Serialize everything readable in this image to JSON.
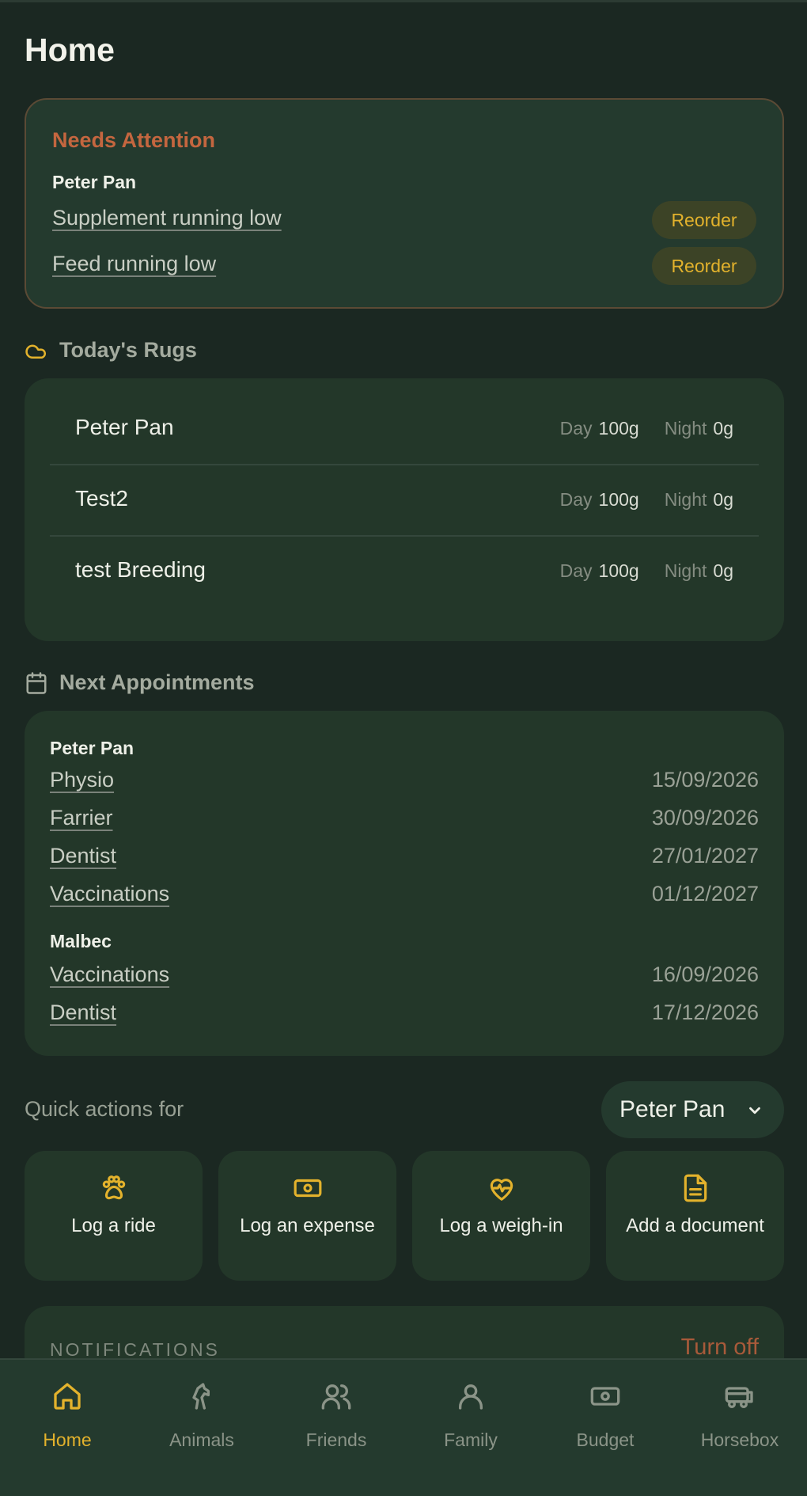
{
  "page": {
    "title": "Home"
  },
  "attention": {
    "title": "Needs Attention",
    "horse": "Peter Pan",
    "items": [
      {
        "label": "Supplement running low",
        "action": "Reorder"
      },
      {
        "label": "Feed running low",
        "action": "Reorder"
      }
    ]
  },
  "rugs": {
    "title": "Today's Rugs",
    "day_label": "Day",
    "night_label": "Night",
    "rows": [
      {
        "name": "Peter Pan",
        "day": "100g",
        "night": "0g"
      },
      {
        "name": "Test2",
        "day": "100g",
        "night": "0g"
      },
      {
        "name": "test Breeding",
        "day": "100g",
        "night": "0g"
      }
    ]
  },
  "appointments": {
    "title": "Next Appointments",
    "groups": [
      {
        "horse": "Peter Pan",
        "items": [
          {
            "type": "Physio",
            "date": "15/09/2026"
          },
          {
            "type": "Farrier",
            "date": "30/09/2026"
          },
          {
            "type": "Dentist",
            "date": "27/01/2027"
          },
          {
            "type": "Vaccinations",
            "date": "01/12/2027"
          }
        ]
      },
      {
        "horse": "Malbec",
        "items": [
          {
            "type": "Vaccinations",
            "date": "16/09/2026"
          },
          {
            "type": "Dentist",
            "date": "17/12/2026"
          }
        ]
      }
    ]
  },
  "quick_actions": {
    "label": "Quick actions for",
    "selected_horse": "Peter Pan",
    "actions": [
      {
        "label": "Log a ride",
        "icon": "paw-icon"
      },
      {
        "label": "Log an expense",
        "icon": "cash-icon"
      },
      {
        "label": "Log a weigh-in",
        "icon": "heart-pulse-icon"
      },
      {
        "label": "Add a document",
        "icon": "document-icon"
      }
    ]
  },
  "notifications": {
    "title": "NOTIFICATIONS",
    "action": "Turn off"
  },
  "nav": {
    "items": [
      {
        "label": "Home",
        "icon": "home-icon",
        "active": true
      },
      {
        "label": "Animals",
        "icon": "horse-icon"
      },
      {
        "label": "Friends",
        "icon": "people-icon"
      },
      {
        "label": "Family",
        "icon": "person-icon"
      },
      {
        "label": "Budget",
        "icon": "cash-icon"
      },
      {
        "label": "Horsebox",
        "icon": "horsebox-icon"
      }
    ]
  },
  "colors": {
    "accent": "#e3b22c",
    "attention": "#c4663f",
    "background": "#1b2822",
    "card": "#233729"
  }
}
